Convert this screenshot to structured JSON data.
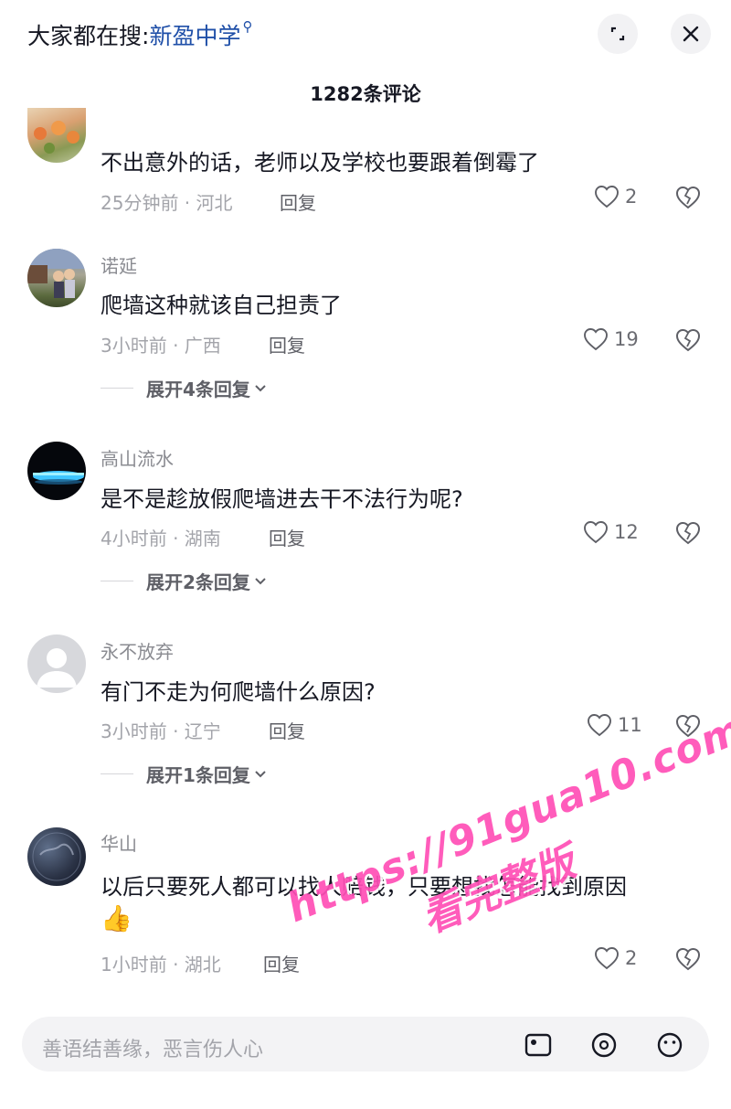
{
  "header": {
    "search_prefix": "大家都在搜:",
    "search_keyword": "新盈中学",
    "comment_count": "1282条评论"
  },
  "comments": [
    {
      "username": "",
      "text": "不出意外的话，老师以及学校也要跟着倒霉了",
      "time_region": "25分钟前 · 河北",
      "reply_label": "回复",
      "likes": "2",
      "expand": ""
    },
    {
      "username": "诺延",
      "text": "爬墙这种就该自己担责了",
      "time_region": "3小时前 · 广西",
      "reply_label": "回复",
      "likes": "19",
      "expand": "展开4条回复"
    },
    {
      "username": "高山流水",
      "text": "是不是趁放假爬墙进去干不法行为呢?",
      "time_region": "4小时前 · 湖南",
      "reply_label": "回复",
      "likes": "12",
      "expand": "展开2条回复"
    },
    {
      "username": "永不放弃",
      "text": "有门不走为何爬墙什么原因?",
      "time_region": "3小时前 · 辽宁",
      "reply_label": "回复",
      "likes": "11",
      "expand": "展开1条回复"
    },
    {
      "username": "华山",
      "text": "以后只要死人都可以找人赔钱，只要想找怎能找到原因",
      "emoji": "👍",
      "time_region": "1小时前 · 湖北",
      "reply_label": "回复",
      "likes": "2",
      "expand": ""
    }
  ],
  "watermark": {
    "url": "https://91gua10.com",
    "subtitle": "看完整版"
  },
  "input": {
    "placeholder": "善语结善缘，恶言伤人心"
  },
  "colors": {
    "keyword": "#1f4fa8",
    "watermark": "#ff4fb6",
    "muted": "#a3a4aa"
  }
}
